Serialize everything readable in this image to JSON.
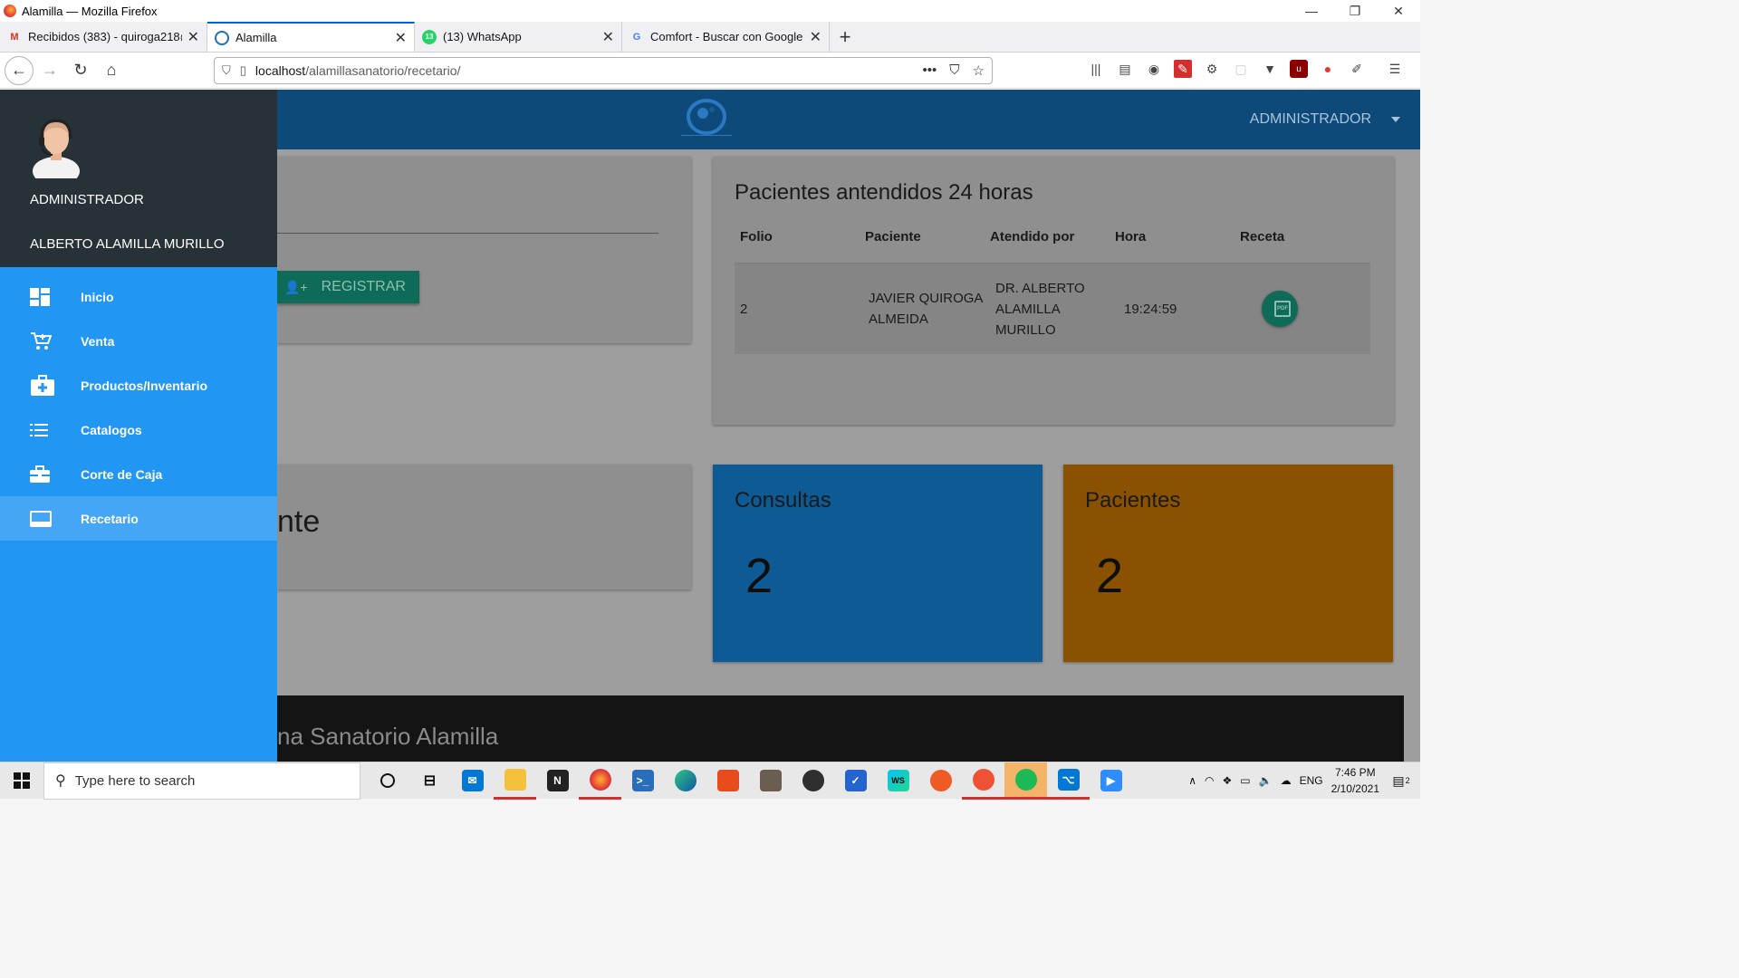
{
  "window": {
    "title": "Alamilla — Mozilla Firefox",
    "controls": [
      "—",
      "❐",
      "✕"
    ]
  },
  "tabs": [
    {
      "label": "Recibidos (383) - quiroga218@",
      "favicon": "gmail-icon",
      "active": false
    },
    {
      "label": "Alamilla",
      "favicon": "site-icon",
      "active": true
    },
    {
      "label": "(13) WhatsApp",
      "favicon": "whatsapp-icon",
      "active": false
    },
    {
      "label": "Comfort - Buscar con Google",
      "favicon": "google-icon",
      "active": false
    }
  ],
  "nav": {
    "url_host": "localhost",
    "url_path": "/alamillasanatorio/recetario/"
  },
  "appbar": {
    "user_label": "ADMINISTRADOR",
    "logo_caption": "SANATORIO ALAMILLA"
  },
  "sidebar": {
    "role": "ADMINISTRADOR",
    "user_name": "ALBERTO ALAMILLA MURILLO",
    "items": [
      {
        "label": "Inicio",
        "icon": "dashboard-icon",
        "active": false
      },
      {
        "label": "Venta",
        "icon": "cart-add-icon",
        "active": false
      },
      {
        "label": "Productos/Inventario",
        "icon": "medical-bag-icon",
        "active": false
      },
      {
        "label": "Catalogos",
        "icon": "list-icon",
        "active": false
      },
      {
        "label": "Corte de Caja",
        "icon": "briefcase-icon",
        "active": false
      },
      {
        "label": "Recetario",
        "icon": "keyboard-icon",
        "active": true
      }
    ]
  },
  "main": {
    "register_button": "REGISTRAR",
    "partial_heading": "nte",
    "patients_card": {
      "title": "Pacientes antendidos 24 horas",
      "columns": [
        "Folio",
        "Paciente",
        "Atendido por",
        "Hora",
        "Receta"
      ],
      "rows": [
        {
          "folio": "2",
          "paciente": "JAVIER QUIROGA ALMEIDA",
          "atendido_por": "DR. ALBERTO ALAMILLA MURILLO",
          "hora": "19:24:59",
          "receta": "PDF"
        }
      ]
    },
    "stats": [
      {
        "label": "Consultas",
        "value": "2",
        "color": "#0d5a95"
      },
      {
        "label": "Pacientes",
        "value": "2",
        "color": "#8a5200"
      }
    ],
    "footer_text": "na Sanatorio Alamilla"
  },
  "taskbar": {
    "search_placeholder": "Type here to search",
    "language": "ENG",
    "time": "7:46 PM",
    "date": "2/10/2021",
    "notifications": "2"
  },
  "colors": {
    "sidebar": "#2196f3",
    "sidebar_header": "#263238",
    "appbar": "#0d4a7a",
    "accent_green": "#0e6b57"
  }
}
